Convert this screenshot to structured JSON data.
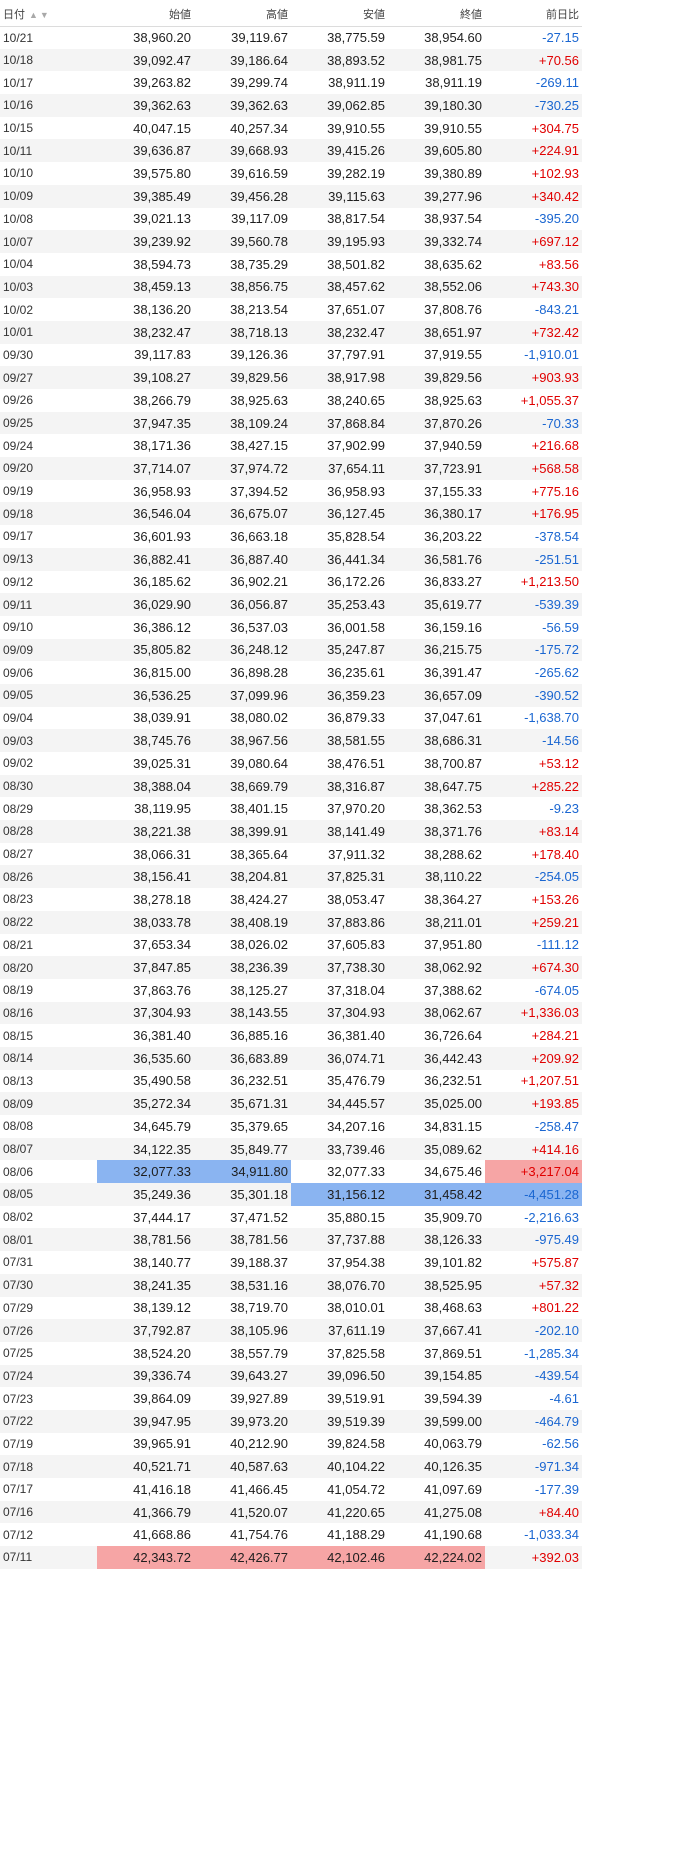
{
  "header": {
    "date": "日付",
    "open": "始値",
    "high": "高値",
    "low": "安値",
    "close": "終値",
    "change": "前日比",
    "sort_icons": "▲▼"
  },
  "colors": {
    "positive": "#e00000",
    "negative": "#1a66d1",
    "highlight_low": "#8ab4f1",
    "highlight_high": "#f6a5a5"
  },
  "rows": [
    {
      "date": "10/21",
      "open": "38,960.20",
      "high": "39,119.67",
      "low": "38,775.59",
      "close": "38,954.60",
      "change": "-27.15"
    },
    {
      "date": "10/18",
      "open": "39,092.47",
      "high": "39,186.64",
      "low": "38,893.52",
      "close": "38,981.75",
      "change": "+70.56"
    },
    {
      "date": "10/17",
      "open": "39,263.82",
      "high": "39,299.74",
      "low": "38,911.19",
      "close": "38,911.19",
      "change": "-269.11"
    },
    {
      "date": "10/16",
      "open": "39,362.63",
      "high": "39,362.63",
      "low": "39,062.85",
      "close": "39,180.30",
      "change": "-730.25"
    },
    {
      "date": "10/15",
      "open": "40,047.15",
      "high": "40,257.34",
      "low": "39,910.55",
      "close": "39,910.55",
      "change": "+304.75"
    },
    {
      "date": "10/11",
      "open": "39,636.87",
      "high": "39,668.93",
      "low": "39,415.26",
      "close": "39,605.80",
      "change": "+224.91"
    },
    {
      "date": "10/10",
      "open": "39,575.80",
      "high": "39,616.59",
      "low": "39,282.19",
      "close": "39,380.89",
      "change": "+102.93"
    },
    {
      "date": "10/09",
      "open": "39,385.49",
      "high": "39,456.28",
      "low": "39,115.63",
      "close": "39,277.96",
      "change": "+340.42"
    },
    {
      "date": "10/08",
      "open": "39,021.13",
      "high": "39,117.09",
      "low": "38,817.54",
      "close": "38,937.54",
      "change": "-395.20"
    },
    {
      "date": "10/07",
      "open": "39,239.92",
      "high": "39,560.78",
      "low": "39,195.93",
      "close": "39,332.74",
      "change": "+697.12"
    },
    {
      "date": "10/04",
      "open": "38,594.73",
      "high": "38,735.29",
      "low": "38,501.82",
      "close": "38,635.62",
      "change": "+83.56"
    },
    {
      "date": "10/03",
      "open": "38,459.13",
      "high": "38,856.75",
      "low": "38,457.62",
      "close": "38,552.06",
      "change": "+743.30"
    },
    {
      "date": "10/02",
      "open": "38,136.20",
      "high": "38,213.54",
      "low": "37,651.07",
      "close": "37,808.76",
      "change": "-843.21"
    },
    {
      "date": "10/01",
      "open": "38,232.47",
      "high": "38,718.13",
      "low": "38,232.47",
      "close": "38,651.97",
      "change": "+732.42"
    },
    {
      "date": "09/30",
      "open": "39,117.83",
      "high": "39,126.36",
      "low": "37,797.91",
      "close": "37,919.55",
      "change": "-1,910.01"
    },
    {
      "date": "09/27",
      "open": "39,108.27",
      "high": "39,829.56",
      "low": "38,917.98",
      "close": "39,829.56",
      "change": "+903.93"
    },
    {
      "date": "09/26",
      "open": "38,266.79",
      "high": "38,925.63",
      "low": "38,240.65",
      "close": "38,925.63",
      "change": "+1,055.37"
    },
    {
      "date": "09/25",
      "open": "37,947.35",
      "high": "38,109.24",
      "low": "37,868.84",
      "close": "37,870.26",
      "change": "-70.33"
    },
    {
      "date": "09/24",
      "open": "38,171.36",
      "high": "38,427.15",
      "low": "37,902.99",
      "close": "37,940.59",
      "change": "+216.68"
    },
    {
      "date": "09/20",
      "open": "37,714.07",
      "high": "37,974.72",
      "low": "37,654.11",
      "close": "37,723.91",
      "change": "+568.58"
    },
    {
      "date": "09/19",
      "open": "36,958.93",
      "high": "37,394.52",
      "low": "36,958.93",
      "close": "37,155.33",
      "change": "+775.16"
    },
    {
      "date": "09/18",
      "open": "36,546.04",
      "high": "36,675.07",
      "low": "36,127.45",
      "close": "36,380.17",
      "change": "+176.95"
    },
    {
      "date": "09/17",
      "open": "36,601.93",
      "high": "36,663.18",
      "low": "35,828.54",
      "close": "36,203.22",
      "change": "-378.54"
    },
    {
      "date": "09/13",
      "open": "36,882.41",
      "high": "36,887.40",
      "low": "36,441.34",
      "close": "36,581.76",
      "change": "-251.51"
    },
    {
      "date": "09/12",
      "open": "36,185.62",
      "high": "36,902.21",
      "low": "36,172.26",
      "close": "36,833.27",
      "change": "+1,213.50"
    },
    {
      "date": "09/11",
      "open": "36,029.90",
      "high": "36,056.87",
      "low": "35,253.43",
      "close": "35,619.77",
      "change": "-539.39"
    },
    {
      "date": "09/10",
      "open": "36,386.12",
      "high": "36,537.03",
      "low": "36,001.58",
      "close": "36,159.16",
      "change": "-56.59"
    },
    {
      "date": "09/09",
      "open": "35,805.82",
      "high": "36,248.12",
      "low": "35,247.87",
      "close": "36,215.75",
      "change": "-175.72"
    },
    {
      "date": "09/06",
      "open": "36,815.00",
      "high": "36,898.28",
      "low": "36,235.61",
      "close": "36,391.47",
      "change": "-265.62"
    },
    {
      "date": "09/05",
      "open": "36,536.25",
      "high": "37,099.96",
      "low": "36,359.23",
      "close": "36,657.09",
      "change": "-390.52"
    },
    {
      "date": "09/04",
      "open": "38,039.91",
      "high": "38,080.02",
      "low": "36,879.33",
      "close": "37,047.61",
      "change": "-1,638.70"
    },
    {
      "date": "09/03",
      "open": "38,745.76",
      "high": "38,967.56",
      "low": "38,581.55",
      "close": "38,686.31",
      "change": "-14.56"
    },
    {
      "date": "09/02",
      "open": "39,025.31",
      "high": "39,080.64",
      "low": "38,476.51",
      "close": "38,700.87",
      "change": "+53.12"
    },
    {
      "date": "08/30",
      "open": "38,388.04",
      "high": "38,669.79",
      "low": "38,316.87",
      "close": "38,647.75",
      "change": "+285.22"
    },
    {
      "date": "08/29",
      "open": "38,119.95",
      "high": "38,401.15",
      "low": "37,970.20",
      "close": "38,362.53",
      "change": "-9.23"
    },
    {
      "date": "08/28",
      "open": "38,221.38",
      "high": "38,399.91",
      "low": "38,141.49",
      "close": "38,371.76",
      "change": "+83.14"
    },
    {
      "date": "08/27",
      "open": "38,066.31",
      "high": "38,365.64",
      "low": "37,911.32",
      "close": "38,288.62",
      "change": "+178.40"
    },
    {
      "date": "08/26",
      "open": "38,156.41",
      "high": "38,204.81",
      "low": "37,825.31",
      "close": "38,110.22",
      "change": "-254.05"
    },
    {
      "date": "08/23",
      "open": "38,278.18",
      "high": "38,424.27",
      "low": "38,053.47",
      "close": "38,364.27",
      "change": "+153.26"
    },
    {
      "date": "08/22",
      "open": "38,033.78",
      "high": "38,408.19",
      "low": "37,883.86",
      "close": "38,211.01",
      "change": "+259.21"
    },
    {
      "date": "08/21",
      "open": "37,653.34",
      "high": "38,026.02",
      "low": "37,605.83",
      "close": "37,951.80",
      "change": "-111.12"
    },
    {
      "date": "08/20",
      "open": "37,847.85",
      "high": "38,236.39",
      "low": "37,738.30",
      "close": "38,062.92",
      "change": "+674.30"
    },
    {
      "date": "08/19",
      "open": "37,863.76",
      "high": "38,125.27",
      "low": "37,318.04",
      "close": "37,388.62",
      "change": "-674.05"
    },
    {
      "date": "08/16",
      "open": "37,304.93",
      "high": "38,143.55",
      "low": "37,304.93",
      "close": "38,062.67",
      "change": "+1,336.03"
    },
    {
      "date": "08/15",
      "open": "36,381.40",
      "high": "36,885.16",
      "low": "36,381.40",
      "close": "36,726.64",
      "change": "+284.21"
    },
    {
      "date": "08/14",
      "open": "36,535.60",
      "high": "36,683.89",
      "low": "36,074.71",
      "close": "36,442.43",
      "change": "+209.92"
    },
    {
      "date": "08/13",
      "open": "35,490.58",
      "high": "36,232.51",
      "low": "35,476.79",
      "close": "36,232.51",
      "change": "+1,207.51"
    },
    {
      "date": "08/09",
      "open": "35,272.34",
      "high": "35,671.31",
      "low": "34,445.57",
      "close": "35,025.00",
      "change": "+193.85"
    },
    {
      "date": "08/08",
      "open": "34,645.79",
      "high": "35,379.65",
      "low": "34,207.16",
      "close": "34,831.15",
      "change": "-258.47"
    },
    {
      "date": "08/07",
      "open": "34,122.35",
      "high": "35,849.77",
      "low": "33,739.46",
      "close": "35,089.62",
      "change": "+414.16"
    },
    {
      "date": "08/06",
      "open": "32,077.33",
      "high": "34,911.80",
      "low": "32,077.33",
      "close": "34,675.46",
      "change": "+3,217.04"
    },
    {
      "date": "08/05",
      "open": "35,249.36",
      "high": "35,301.18",
      "low": "31,156.12",
      "close": "31,458.42",
      "change": "-4,451.28"
    },
    {
      "date": "08/02",
      "open": "37,444.17",
      "high": "37,471.52",
      "low": "35,880.15",
      "close": "35,909.70",
      "change": "-2,216.63"
    },
    {
      "date": "08/01",
      "open": "38,781.56",
      "high": "38,781.56",
      "low": "37,737.88",
      "close": "38,126.33",
      "change": "-975.49"
    },
    {
      "date": "07/31",
      "open": "38,140.77",
      "high": "39,188.37",
      "low": "37,954.38",
      "close": "39,101.82",
      "change": "+575.87"
    },
    {
      "date": "07/30",
      "open": "38,241.35",
      "high": "38,531.16",
      "low": "38,076.70",
      "close": "38,525.95",
      "change": "+57.32"
    },
    {
      "date": "07/29",
      "open": "38,139.12",
      "high": "38,719.70",
      "low": "38,010.01",
      "close": "38,468.63",
      "change": "+801.22"
    },
    {
      "date": "07/26",
      "open": "37,792.87",
      "high": "38,105.96",
      "low": "37,611.19",
      "close": "37,667.41",
      "change": "-202.10"
    },
    {
      "date": "07/25",
      "open": "38,524.20",
      "high": "38,557.79",
      "low": "37,825.58",
      "close": "37,869.51",
      "change": "-1,285.34"
    },
    {
      "date": "07/24",
      "open": "39,336.74",
      "high": "39,643.27",
      "low": "39,096.50",
      "close": "39,154.85",
      "change": "-439.54"
    },
    {
      "date": "07/23",
      "open": "39,864.09",
      "high": "39,927.89",
      "low": "39,519.91",
      "close": "39,594.39",
      "change": "-4.61"
    },
    {
      "date": "07/22",
      "open": "39,947.95",
      "high": "39,973.20",
      "low": "39,519.39",
      "close": "39,599.00",
      "change": "-464.79"
    },
    {
      "date": "07/19",
      "open": "39,965.91",
      "high": "40,212.90",
      "low": "39,824.58",
      "close": "40,063.79",
      "change": "-62.56"
    },
    {
      "date": "07/18",
      "open": "40,521.71",
      "high": "40,587.63",
      "low": "40,104.22",
      "close": "40,126.35",
      "change": "-971.34"
    },
    {
      "date": "07/17",
      "open": "41,416.18",
      "high": "41,466.45",
      "low": "41,054.72",
      "close": "41,097.69",
      "change": "-177.39"
    },
    {
      "date": "07/16",
      "open": "41,366.79",
      "high": "41,520.07",
      "low": "41,220.65",
      "close": "41,275.08",
      "change": "+84.40"
    },
    {
      "date": "07/12",
      "open": "41,668.86",
      "high": "41,754.76",
      "low": "41,188.29",
      "close": "41,190.68",
      "change": "-1,033.34"
    },
    {
      "date": "07/11",
      "open": "42,343.72",
      "high": "42,426.77",
      "low": "42,102.46",
      "close": "42,224.02",
      "change": "+392.03"
    }
  ]
}
